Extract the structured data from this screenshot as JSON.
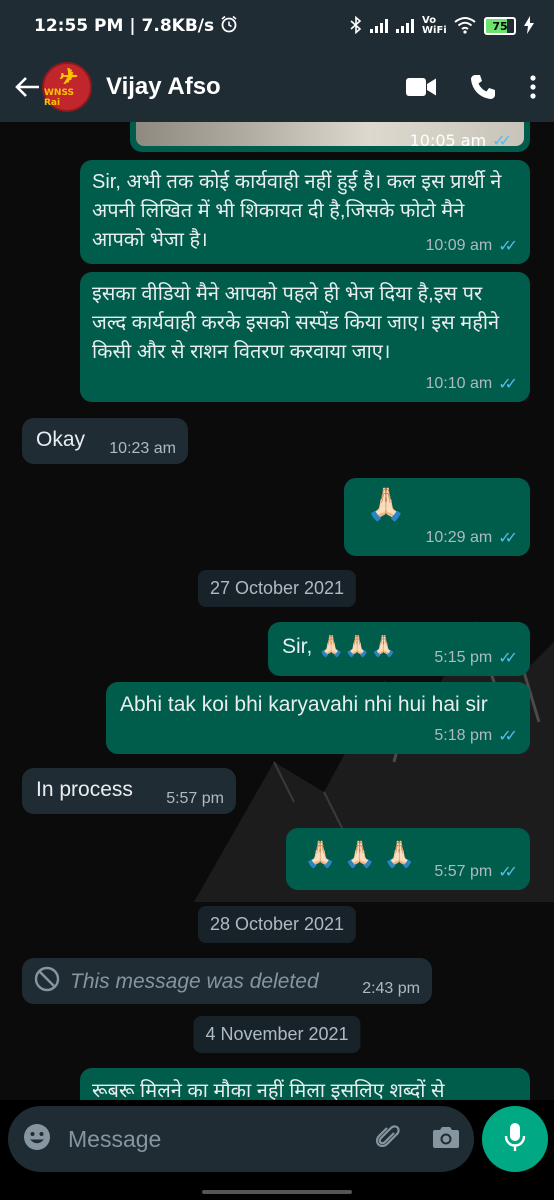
{
  "status_bar": {
    "time": "12:55 PM",
    "speed": "| 7.8KB/s",
    "network": "Vo WiFi",
    "battery": "75"
  },
  "header": {
    "avatar_label": "WNSS Rai",
    "contact_name": "Vijay Afso"
  },
  "messages": [
    {
      "type": "outgoing-image",
      "time": "10:05 am"
    },
    {
      "type": "outgoing",
      "text": "Sir, अभी तक कोई कार्यवाही नहीं हुई है। कल इस प्रार्थी ने अपनी लिखित में भी शिकायत दी है,जिसके फोटो मैने आपको भेजा है।",
      "time": "10:09 am"
    },
    {
      "type": "outgoing",
      "text": "इसका वीडियो मैने आपको पहले ही भेज दिया है,इस पर जल्द कार्यवाही करके इसको सस्पेंड किया जाए। इस महीने किसी और से राशन वितरण करवाया जाए।",
      "time": "10:10 am"
    },
    {
      "type": "incoming",
      "text": "Okay",
      "time": "10:23 am"
    },
    {
      "type": "outgoing",
      "text": "🙏🏻",
      "time": "10:29 am"
    },
    {
      "type": "date",
      "text": "27 October 2021"
    },
    {
      "type": "outgoing",
      "text": "Sir, 🙏🏻🙏🏻🙏🏻",
      "time": "5:15 pm"
    },
    {
      "type": "outgoing",
      "text": "Abhi tak koi bhi karyavahi nhi hui hai sir",
      "time": "5:18 pm"
    },
    {
      "type": "incoming",
      "text": "In process",
      "time": "5:57 pm"
    },
    {
      "type": "outgoing",
      "text": "🙏🏻 🙏🏻 🙏🏻",
      "time": "5:57 pm"
    },
    {
      "type": "date",
      "text": "28 October 2021"
    },
    {
      "type": "incoming-deleted",
      "text": "This message was deleted",
      "time": "2:43 pm"
    },
    {
      "type": "date",
      "text": "4 November 2021"
    },
    {
      "type": "outgoing-partial",
      "text": "रूबरू मिलने का  मौका नहीं मिला इसलिए शब्दों से"
    }
  ],
  "input": {
    "placeholder": "Message"
  },
  "colors": {
    "outgoing_bubble": "#005c4b",
    "incoming_bubble": "#202c33",
    "read_tick": "#53bdeb",
    "accent": "#00a884"
  },
  "icons": [
    "back-arrow-icon",
    "video-call-icon",
    "phone-icon",
    "more-options-icon",
    "emoji-icon",
    "attach-icon",
    "camera-icon",
    "mic-icon",
    "deleted-icon",
    "double-tick-icon"
  ]
}
